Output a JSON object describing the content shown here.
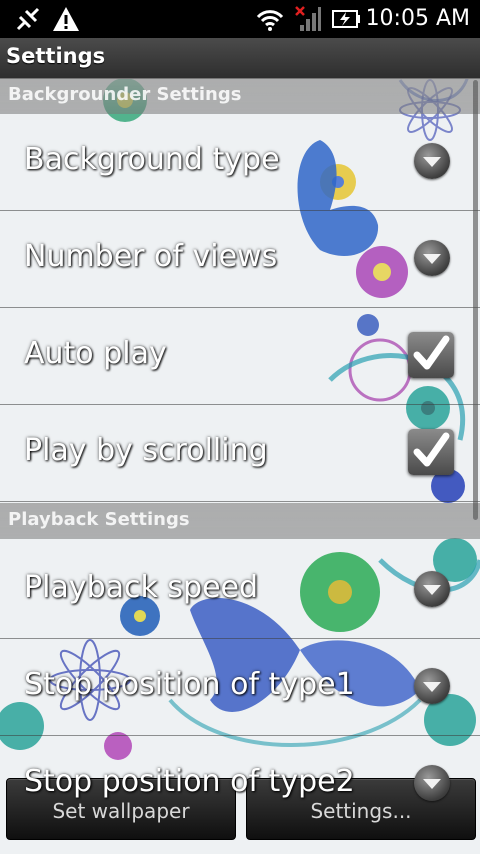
{
  "status_bar": {
    "time": "10:05 AM",
    "icons": [
      "usb-debug-icon",
      "warning-icon",
      "wifi-icon",
      "no-signal-icon",
      "battery-charging-icon"
    ]
  },
  "title": "Settings",
  "sections": [
    {
      "header": "Backgrounder Settings",
      "rows": [
        {
          "label": "Background type",
          "control": "dropdown"
        },
        {
          "label": "Number of views",
          "control": "dropdown"
        },
        {
          "label": "Auto play",
          "control": "checkbox",
          "checked": true
        },
        {
          "label": "Play by scrolling",
          "control": "checkbox",
          "checked": true
        }
      ]
    },
    {
      "header": "Playback Settings",
      "rows": [
        {
          "label": "Playback speed",
          "control": "dropdown"
        },
        {
          "label": "Stop position of type1",
          "control": "dropdown"
        },
        {
          "label": "Stop position of type2",
          "control": "dropdown"
        }
      ]
    }
  ],
  "bottom_buttons": {
    "set_wallpaper": "Set wallpaper",
    "settings": "Settings..."
  }
}
